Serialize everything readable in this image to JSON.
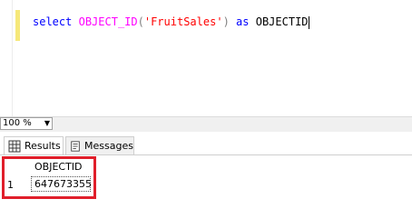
{
  "editor": {
    "tokens": {
      "kw1": "select",
      "sp1": " ",
      "fn": "OBJECT_ID",
      "open_paren": "(",
      "str": "'FruitSales'",
      "close_paren": ")",
      "sp2": " ",
      "kw2": "as",
      "sp3": " ",
      "alias": "OBJECTID"
    }
  },
  "zoom": {
    "value": "100 %"
  },
  "tabs": [
    {
      "label": "Results",
      "icon": "grid-icon",
      "selected": true
    },
    {
      "label": "Messages",
      "icon": "messages-icon",
      "selected": false
    }
  ],
  "results": {
    "columns": [
      "OBJECTID"
    ],
    "rows": [
      {
        "num": "1",
        "cells": [
          "647673355"
        ]
      }
    ]
  },
  "colors": {
    "keyword": "#0000ff",
    "function": "#ff00ff",
    "string": "#ff0000",
    "highlight": "#e01e2a"
  }
}
